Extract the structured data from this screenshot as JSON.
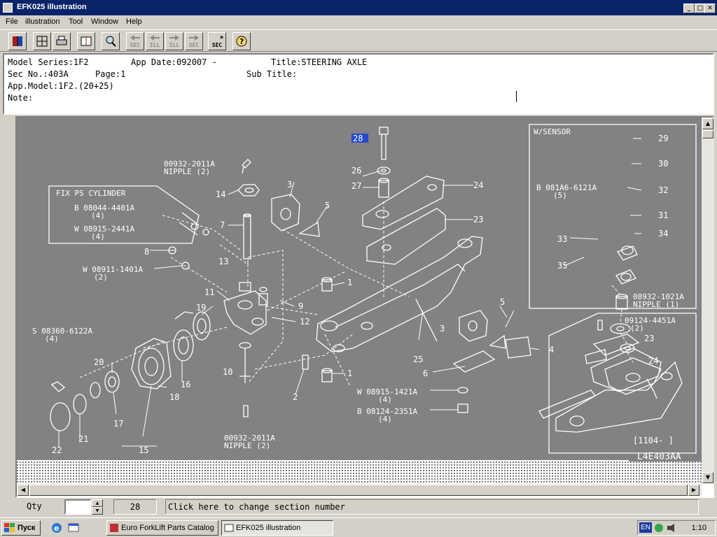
{
  "window": {
    "title": "EFK025 illustration"
  },
  "menu": [
    "File",
    "illustration",
    "Tool",
    "Window",
    "Help"
  ],
  "toolbar": {
    "sec_text": "SEC",
    "ill_text": "ILL"
  },
  "info": {
    "model_series": "Model Series:1F2",
    "app_date": "App Date:092007 -",
    "title": "Title:STEERING AXLE",
    "sec_no": "Sec No.:403A",
    "page": "Page:1",
    "sub_title": "Sub Title:",
    "app_model": "App.Model:1F2.(20+25)",
    "note": "Note:"
  },
  "diagram": {
    "highlight_ref": "28",
    "drawing_code": "L4E403AA",
    "fix_ps_cylinder": "FIX PS CYLINDER",
    "w_sensor": "W/SENSOR",
    "serial_range": "[1104-    ]",
    "callouts": [
      "26",
      "27",
      "24",
      "23",
      "3",
      "5",
      "14",
      "7",
      "8",
      "13",
      "11",
      "9",
      "12",
      "19",
      "1",
      "1",
      "2",
      "10",
      "20",
      "16",
      "18",
      "17",
      "15",
      "21",
      "22",
      "25",
      "3",
      "5",
      "4",
      "6",
      "29",
      "30",
      "32",
      "31",
      "34",
      "33",
      "35",
      "23",
      "24"
    ],
    "part_labels": [
      "00932-2011A",
      "NIPPLE (2)",
      "B 08044-4401A",
      "(4)",
      "W 08915-2441A",
      "(4)",
      "W 08911-1401A",
      "(2)",
      "S 08360-6122A",
      "(4)",
      "00932-2011A",
      "NIPPLE (2)",
      "W 08915-1421A",
      "(4)",
      "B 08124-2351A",
      "(4)",
      "B 081A6-6121A",
      "(5)",
      "08932-1021A",
      "NIPPLE (1)",
      "09124-4451A",
      "(2)"
    ]
  },
  "status": {
    "qty_label": "Qty",
    "qty_value": "",
    "section_number": "28",
    "message": "Click here to change section number"
  },
  "taskbar": {
    "start": "Пуск",
    "task1": "Euro ForkLift Parts Catalog",
    "task2": "EFK025 illustration",
    "lang": "EN",
    "clock": "1:10"
  }
}
